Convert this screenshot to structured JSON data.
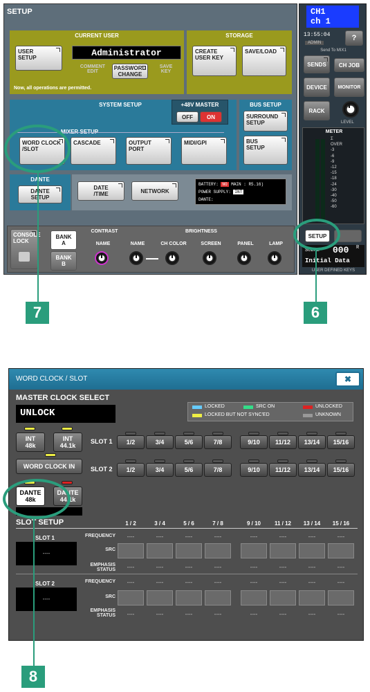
{
  "setup": {
    "title": "SETUP",
    "current_user": {
      "title": "CURRENT USER",
      "user_setup": "USER\nSETUP",
      "user_name": "Administrator",
      "comment_edit": "COMMENT\nEDIT",
      "password_change": "PASSWORD\nCHANGE",
      "save_key": "SAVE\nKEY",
      "status": "Now, all operations are permitted."
    },
    "storage": {
      "title": "STORAGE",
      "create_user_key": "CREATE\nUSER KEY",
      "save_load": "SAVE/LOAD"
    },
    "system_setup": {
      "title": "SYSTEM SETUP",
      "master_48v": "+48V MASTER",
      "off": "OFF",
      "on": "ON",
      "mixer_setup": "MIXER SETUP",
      "word_clock_slot": "WORD CLOCK\n/SLOT",
      "cascade": "CASCADE",
      "output_port": "OUTPUT\nPORT",
      "midi_gpi": "MIDI/GPI"
    },
    "bus_setup": {
      "title": "BUS SETUP",
      "surround_setup": "SURROUND\nSETUP",
      "bus_setup_btn": "BUS\nSETUP"
    },
    "dante": {
      "title": "DANTE",
      "dante_setup": "DANTE\nSETUP"
    },
    "date_time": "DATE\n/TIME",
    "network": "NETWORK",
    "status_box": {
      "battery": "BATTERY:",
      "battery_value": "NO",
      "main": "MAIN : R5.16)",
      "power_supply": "POWER SUPPLY:",
      "power_value": "INT",
      "dante": "DANTE:"
    },
    "console_lock": "CONSOLE\nLOCK",
    "bank_a": "BANK A",
    "bank_b": "BANK B",
    "contrast": "CONTRAST",
    "brightness": "BRIGHTNESS",
    "knob_labels": [
      "NAME",
      "NAME",
      "CH COLOR",
      "SCREEN",
      "PANEL",
      "LAMP"
    ],
    "side": {
      "ch_top": "CH1",
      "ch_bottom": "ch 1",
      "time": "13:55:04",
      "admin": "ADMIN",
      "help": "?",
      "help_label": "HELP",
      "send_to": "Send To MIX1",
      "sends": "SENDS",
      "ch_job": "CH JOB",
      "device": "DEVICE",
      "monitor": "MONITOR",
      "rack": "RACK",
      "level": "LEVEL",
      "meter": "METER",
      "meter_scale": [
        "Σ",
        "OVER",
        "-3",
        "-6",
        "-9",
        "-12",
        "-15",
        "-18",
        "-24",
        "-30",
        "-40",
        "-50",
        "-60"
      ],
      "setup_btn": "SETUP",
      "scene_label": "SCENE",
      "scene_num": "000",
      "scene_r": "R",
      "scene_name": "Initial Data",
      "user_keys": "USER DEFINED KEYS"
    },
    "callout_7": "7",
    "callout_6": "6"
  },
  "wordclock": {
    "title": "WORD CLOCK / SLOT",
    "close": "✖",
    "master_clock_select": "MASTER CLOCK SELECT",
    "status": "UNLOCK",
    "legend": {
      "locked": "LOCKED",
      "src_on": "SRC ON",
      "unlocked": "UNLOCKED",
      "locked_not_synced": "LOCKED BUT NOT SYNC'ED",
      "unknown": "UNKNOWN"
    },
    "int48": "INT\n48k",
    "int441": "INT\n44.1k",
    "word_clock_in": "WORD CLOCK IN",
    "dante48": "DANTE\n48k",
    "dante441": "DANTE\n44.1k",
    "slot1": "SLOT 1",
    "slot2": "SLOT 2",
    "slot_buttons": [
      "1/2",
      "3/4",
      "5/6",
      "7/8",
      "9/10",
      "11/12",
      "13/14",
      "15/16"
    ],
    "slot_setup": "SLOT SETUP",
    "columns": [
      "1 / 2",
      "3 / 4",
      "5 / 6",
      "7 / 8",
      "9 / 10",
      "11 / 12",
      "13 / 14",
      "15 / 16"
    ],
    "frequency": "FREQUENCY",
    "src": "SRC",
    "emphasis": "EMPHASIS\nSTATUS",
    "slot_display": "----",
    "dash": "----",
    "callout_8": "8"
  }
}
